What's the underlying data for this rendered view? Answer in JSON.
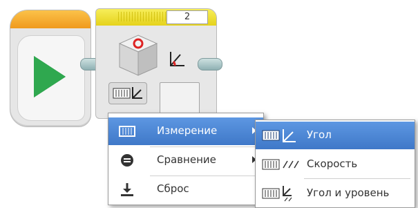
{
  "sensor_block": {
    "port_value": "2",
    "icons": [
      "rotation-sensor-cube-icon",
      "angle-icon",
      "mode-selector-icon"
    ]
  },
  "start_block": {
    "icons": [
      "play-icon"
    ]
  },
  "mode_menu": {
    "items": [
      {
        "label": "Измерение",
        "icon": "measure-icon",
        "has_submenu": true,
        "selected": true
      },
      {
        "label": "Сравнение",
        "icon": "compare-icon",
        "has_submenu": true,
        "selected": false
      },
      {
        "label": "Сброс",
        "icon": "reset-icon",
        "has_submenu": false,
        "selected": false
      }
    ]
  },
  "measure_submenu": {
    "items": [
      {
        "label": "Угол",
        "icon": "angle-mode-icon",
        "selected": true
      },
      {
        "label": "Скорость",
        "icon": "speed-mode-icon",
        "selected": false
      },
      {
        "label": "Угол и уровень",
        "icon": "angle-rate-mode-icon",
        "selected": false
      }
    ]
  },
  "colors": {
    "start_bar": "#f09a1e",
    "sensor_bar": "#e5d21b",
    "play": "#2fa84f",
    "selection": "#4a86d6"
  }
}
